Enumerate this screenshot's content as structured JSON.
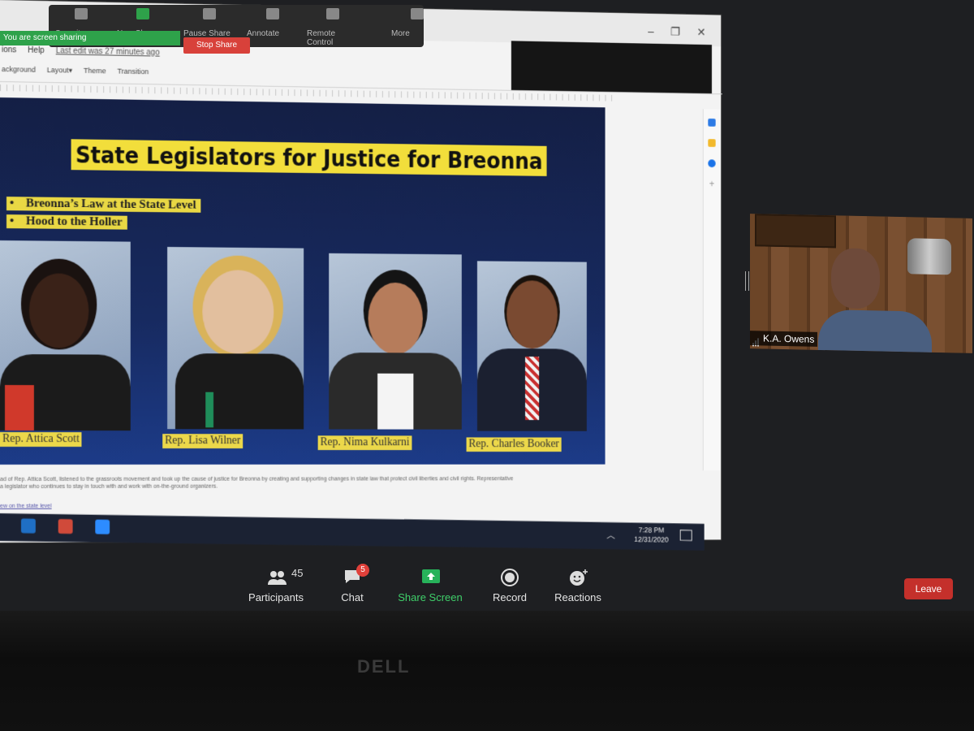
{
  "zoom_share_toolbar": {
    "items": [
      {
        "label": "Security",
        "color": "#888888"
      },
      {
        "label": "New Share",
        "color": "#2ea24a"
      },
      {
        "label": "Pause Share",
        "color": "#888888"
      },
      {
        "label": "Annotate",
        "color": "#888888"
      },
      {
        "label": "Remote Control",
        "color": "#888888"
      },
      {
        "label": "More",
        "color": "#888888"
      }
    ],
    "sharing_label": "You are screen sharing",
    "stop_share": "Stop Share"
  },
  "app": {
    "menu": [
      "ions",
      "Help",
      "Last edit was 27 minutes ago"
    ],
    "toolbar": [
      "ackground",
      "Layout▾",
      "Theme",
      "Transition"
    ],
    "window_controls": [
      "–",
      "❐",
      "✕"
    ]
  },
  "slide": {
    "title": "State Legislators for Justice for Breonna",
    "bullets": [
      "Breonna’s Law at the State Level",
      "Hood to the Holler"
    ],
    "legislators": [
      {
        "caption": "Rep. Attica Scott"
      },
      {
        "caption": "Rep. Lisa Wilner"
      },
      {
        "caption": "Rep. Nima Kulkarni"
      },
      {
        "caption": "Rep. Charles Booker"
      }
    ]
  },
  "speaker_notes": {
    "line1": "ad of Rep. Attica Scott, listened to the grassroots movement and took up the cause of justice for Breonna by creating and supporting changes in state law that protect civil liberties and civil rights. Representative",
    "line2": "a legislator who continues to stay in touch with and work with on-the-ground organizers.",
    "link": "ew on the state level"
  },
  "taskbar": {
    "time": "7:28 PM",
    "date": "12/31/2020",
    "tray": "︿",
    "icons": [
      {
        "name": "outlook-icon",
        "color": "#1f6fc5"
      },
      {
        "name": "app-icon",
        "color": "#d04a3a"
      },
      {
        "name": "zoom-icon",
        "color": "#2d8cff"
      }
    ]
  },
  "video_tile": {
    "participant_name": "K.A. Owens"
  },
  "meeting_bar": {
    "participants_label": "Participants",
    "participants_count": "45",
    "chat_label": "Chat",
    "chat_badge": "5",
    "share_label": "Share Screen",
    "record_label": "Record",
    "reactions_label": "Reactions",
    "leave_label": "Leave"
  },
  "monitor_brand": "DELL"
}
